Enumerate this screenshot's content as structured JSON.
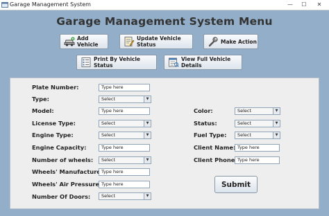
{
  "window": {
    "title": "Garage Management System",
    "controls": {
      "minimize": "—",
      "maximize": "☐",
      "close": "✕"
    }
  },
  "heading": "Garage Management System Menu",
  "toolbar": {
    "add_vehicle": "Add Vehicle",
    "update_status": "Update Vehicle Status",
    "make_action": "Make Action",
    "print_status": "Print By Vehicle Status",
    "view_details": "View Full Vehicle Details"
  },
  "form": {
    "plate_number": {
      "label": "Plate Number:",
      "placeholder": "Type here"
    },
    "type": {
      "label": "Type:",
      "value": "Select"
    },
    "model": {
      "label": "Model:",
      "placeholder": "Type here"
    },
    "license_type": {
      "label": "License Type:",
      "value": "Select"
    },
    "engine_type": {
      "label": "Engine Type:",
      "value": "Select"
    },
    "engine_capacity": {
      "label": "Engine Capacity:",
      "placeholder": "Type here"
    },
    "number_of_wheels": {
      "label": "Number of wheels:",
      "value": "Select"
    },
    "wheels_manufacturer": {
      "label": "Wheels' Manufacturer:",
      "placeholder": "Type here"
    },
    "wheels_air_pressure": {
      "label": "Wheels' Air Pressure:",
      "placeholder": "Type here"
    },
    "number_of_doors": {
      "label": "Number Of Doors:",
      "value": "Select"
    },
    "color": {
      "label": "Color:",
      "value": "Select"
    },
    "status": {
      "label": "Status:",
      "value": "Select"
    },
    "fuel_type": {
      "label": "Fuel Type:",
      "value": "Select"
    },
    "client_name": {
      "label": "Client Name:",
      "placeholder": "Type here"
    },
    "client_phone": {
      "label": "Client Phone:",
      "placeholder": "Type here"
    },
    "submit": "Submit"
  },
  "icons": {
    "app": "app-icon",
    "add_vehicle": "car-icon",
    "update_status": "edit-document-icon",
    "make_action": "wrench-icon",
    "print_status": "list-icon",
    "view_details": "document-view-icon"
  },
  "colors": {
    "frame_background": "#93aec8",
    "panel_background": "#eeeeee"
  }
}
